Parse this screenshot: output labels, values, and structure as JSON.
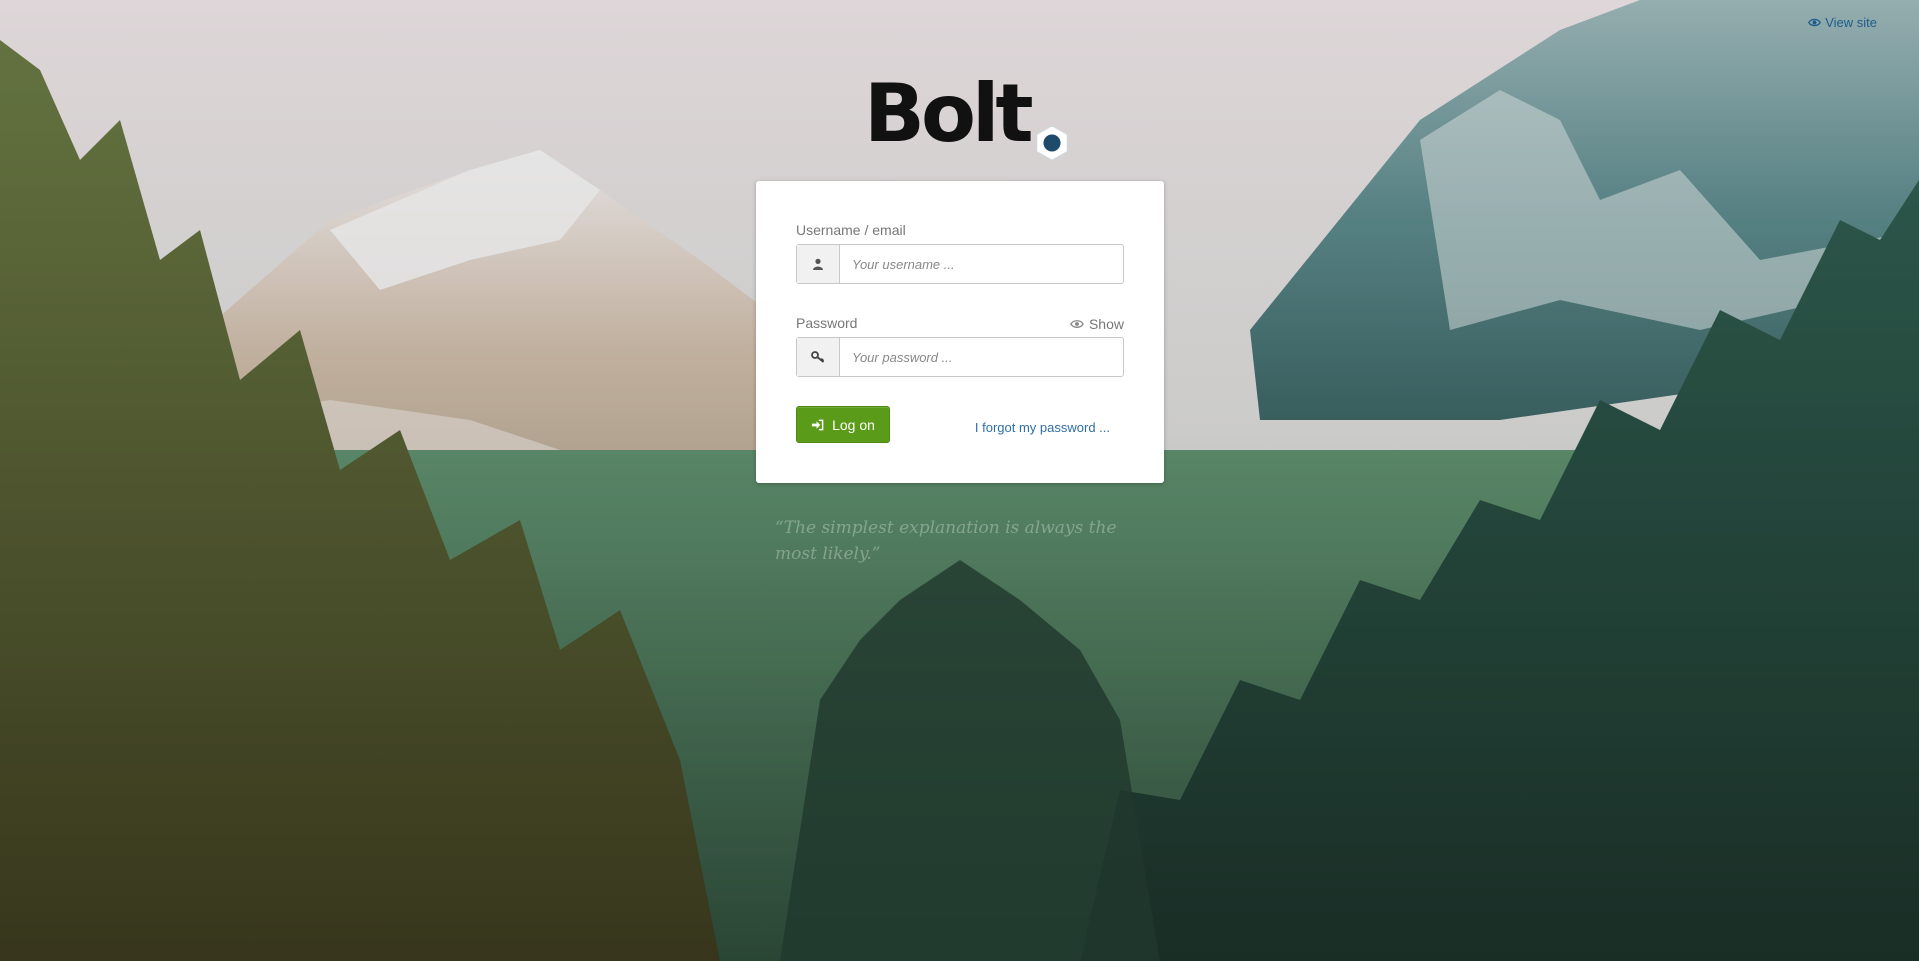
{
  "header": {
    "view_site_label": "View site",
    "view_site_icon": "eye-icon"
  },
  "logo": {
    "text": "Bolt",
    "mark_icon": "bolt-hexagon-icon"
  },
  "login": {
    "username_label": "Username / email",
    "username_placeholder": "Your username ...",
    "username_icon": "user-icon",
    "password_label": "Password",
    "password_placeholder": "Your password ...",
    "password_icon": "key-icon",
    "show_label": "Show",
    "show_icon": "eye-icon",
    "submit_label": "Log on",
    "submit_icon": "sign-in-icon",
    "forgot_label": "I forgot my password ..."
  },
  "quote": {
    "text": "“The simplest explanation is always the most likely.”"
  },
  "colors": {
    "primary_button": "#5a9b19",
    "link": "#2f6ea8"
  }
}
